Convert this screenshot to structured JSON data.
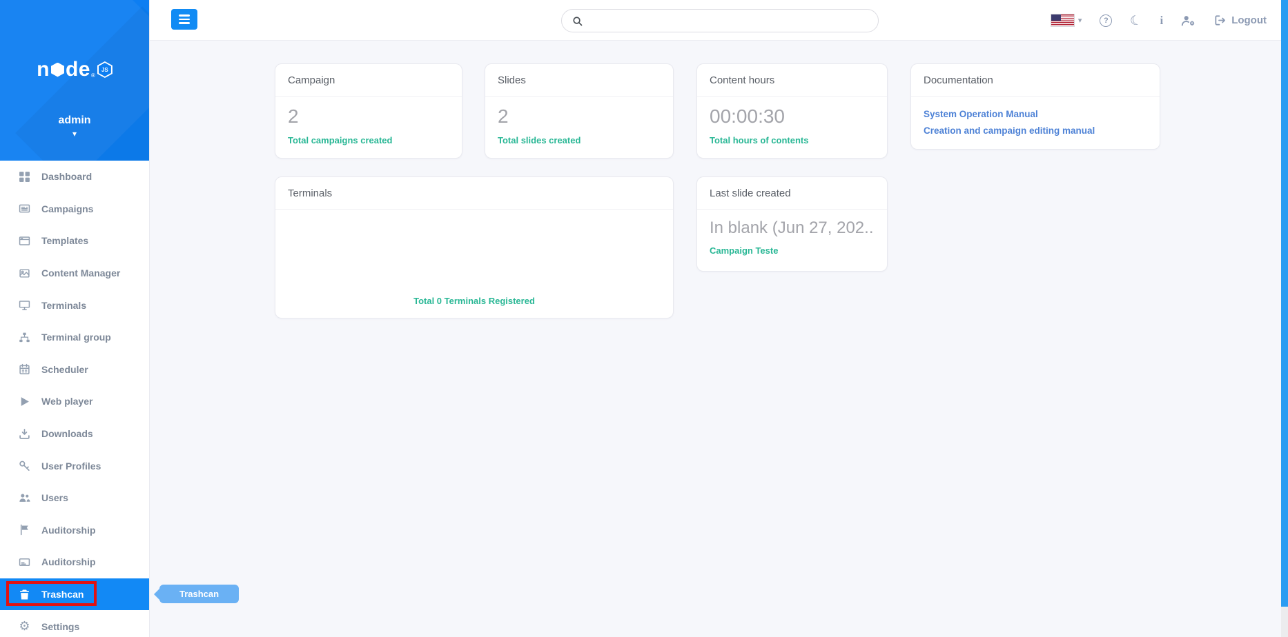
{
  "topbar": {
    "search": {
      "placeholder": ""
    },
    "logout_label": "Logout"
  },
  "icons": {
    "caret_down": "▾",
    "moon": "☾",
    "info": "i",
    "question": "?",
    "play": "▶",
    "gear": "⚙"
  },
  "sidebar": {
    "logo": {
      "text_left": "n",
      "text_right": "de",
      "registered": "®",
      "badge": "JS"
    },
    "user": {
      "name": "admin"
    },
    "items": [
      {
        "label": "Dashboard",
        "icon": "dashboard-icon"
      },
      {
        "label": "Campaigns",
        "icon": "newspaper-icon"
      },
      {
        "label": "Templates",
        "icon": "window-icon"
      },
      {
        "label": "Content Manager",
        "icon": "images-icon"
      },
      {
        "label": "Terminals",
        "icon": "desktop-icon"
      },
      {
        "label": "Terminal group",
        "icon": "sitemap-icon"
      },
      {
        "label": "Scheduler",
        "icon": "calendar-icon"
      },
      {
        "label": "Web player",
        "icon": "play-icon"
      },
      {
        "label": "Downloads",
        "icon": "download-icon"
      },
      {
        "label": "User Profiles",
        "icon": "key-icon"
      },
      {
        "label": "Users",
        "icon": "users-icon"
      },
      {
        "label": "Auditorship",
        "icon": "flag-icon"
      },
      {
        "label": "Auditorship",
        "icon": "card-icon"
      },
      {
        "label": "Trashcan",
        "icon": "trash-icon",
        "active": true
      },
      {
        "label": "Settings",
        "icon": "gear-icon"
      }
    ]
  },
  "tooltip": {
    "label": "Trashcan"
  },
  "cards": {
    "campaign": {
      "title": "Campaign",
      "value": "2",
      "caption": "Total campaigns created"
    },
    "slides": {
      "title": "Slides",
      "value": "2",
      "caption": "Total slides created"
    },
    "content_hours": {
      "title": "Content hours",
      "value": "00:00:30",
      "caption": "Total hours of contents"
    },
    "documentation": {
      "title": "Documentation",
      "links": [
        "System Operation Manual",
        "Creation and campaign editing manual"
      ]
    },
    "terminals": {
      "title": "Terminals",
      "caption": "Total 0 Terminals Registered"
    },
    "last_slide": {
      "title": "Last slide created",
      "value": "In blank (Jun 27, 202...",
      "caption": "Campaign Teste"
    }
  },
  "colors": {
    "sidebar_header_blue": "#0d7ef2",
    "active_item_blue": "#1289f5",
    "hamburger_blue": "#118bf4",
    "tooltip_blue": "#6ab1f4",
    "teal_caption": "#29b795",
    "doc_link_blue": "#4e82d6",
    "annotation_red": "#e11212",
    "scrollbar_thumb_blue": "#2b9cf2"
  }
}
